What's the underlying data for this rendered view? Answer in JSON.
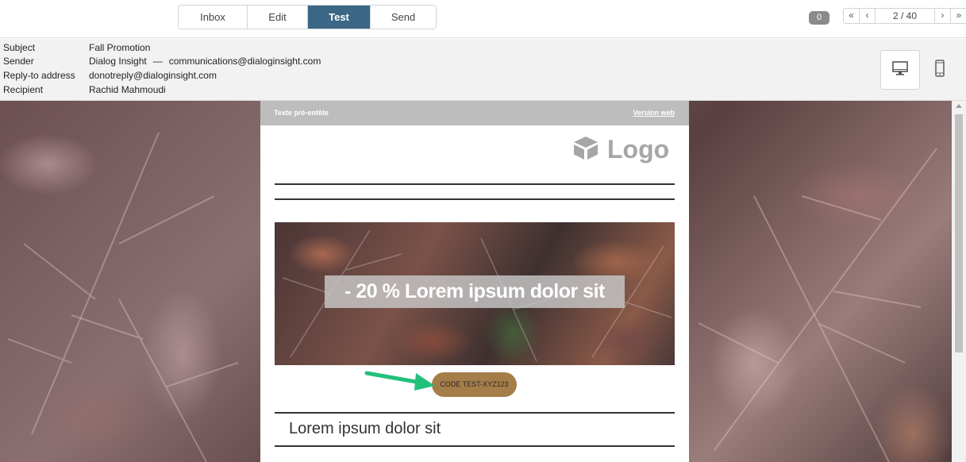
{
  "tabs": [
    {
      "label": "Inbox",
      "active": false
    },
    {
      "label": "Edit",
      "active": false
    },
    {
      "label": "Test",
      "active": true
    },
    {
      "label": "Send",
      "active": false
    }
  ],
  "badge": "0",
  "pager": {
    "first": "«",
    "prev": "‹",
    "current": "2 / 40",
    "next": "›",
    "last": "»"
  },
  "headers": {
    "subject_label": "Subject",
    "subject_value": "Fall Promotion",
    "sender_label": "Sender",
    "sender_name": "Dialog Insight",
    "sender_sep": "—",
    "sender_email": "communications@dialoginsight.com",
    "reply_label": "Reply-to address",
    "reply_value": "donotreply@dialoginsight.com",
    "recipient_label": "Recipient",
    "recipient_value": "Rachid Mahmoudi"
  },
  "view_toggle": {
    "desktop_icon": "desktop-monitor-icon",
    "mobile_icon": "mobile-phone-icon",
    "active": "desktop"
  },
  "email": {
    "preheader_text": "Texte pré-entête",
    "web_version": "Version web",
    "logo_text": "Logo",
    "logo_icon": "cube-icon",
    "hero_text": "- 20 % Lorem ipsum dolor sit",
    "code_button": "CODE TEST-XYZ123",
    "section_title": "Lorem ipsum dolor sit"
  },
  "colors": {
    "active_tab": "#3b6685",
    "code_button": "#a57d48",
    "arrow": "#22c07a",
    "preheader_bar": "#bdbdbd"
  }
}
